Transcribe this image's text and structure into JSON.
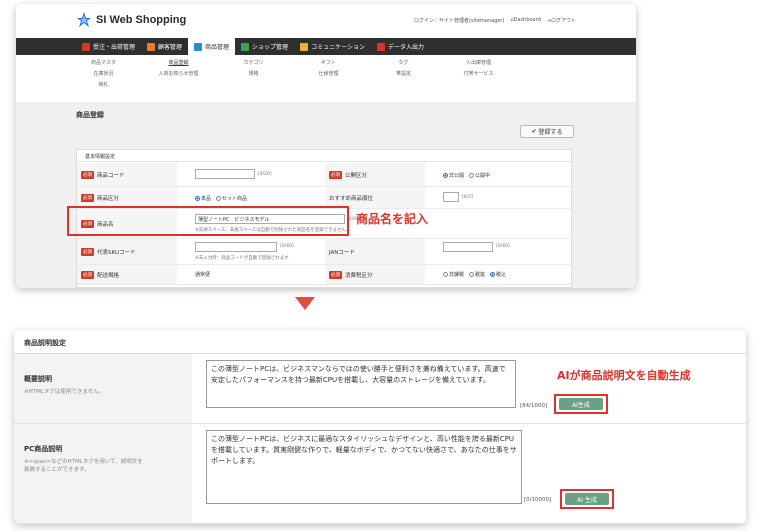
{
  "app": {
    "logo_text": "SI Web Shopping",
    "header_links": [
      "ログイン：サイト管理者(sitemanager)",
      "Dashboard",
      "ログアウト"
    ]
  },
  "nav": {
    "items": [
      {
        "label": "受注・出荷管理",
        "icon": "clipboard-icon",
        "color": "#d23a2a"
      },
      {
        "label": "顧客管理",
        "icon": "person-icon",
        "color": "#e67b2e"
      },
      {
        "label": "商品管理",
        "icon": "grid-icon",
        "color": "#2a8ad6",
        "active": true
      },
      {
        "label": "ショップ管理",
        "icon": "cart-icon",
        "color": "#3aa555"
      },
      {
        "label": "コミュニケーション",
        "icon": "chat-icon",
        "color": "#f0b429"
      },
      {
        "label": "データ入出力",
        "icon": "check-icon",
        "color": "#e0322b"
      }
    ]
  },
  "subnav": {
    "row1": [
      "商品マスタ",
      "商品登録",
      "カテゴリ",
      "ギフト",
      "タグ",
      "入出庫管理"
    ],
    "row2": [
      "在庫状況",
      "入荷お知らせ管理",
      "規格",
      "仕様管理",
      "帯設定",
      "付帯サービス"
    ],
    "row3": [
      "荷札"
    ],
    "active": "商品登録"
  },
  "page": {
    "title": "商品登録",
    "register_button": "登録する"
  },
  "basic_panel": {
    "header": "基本情報設定",
    "required_badge": "必須",
    "product_code": {
      "label": "商品コード",
      "count": "[0/20]"
    },
    "publish": {
      "label": "公開区分",
      "options": [
        "非公開",
        "公開中"
      ]
    },
    "product_type": {
      "label": "商品区分",
      "options": [
        "単品",
        "セット商品"
      ]
    },
    "recommend": {
      "label": "おすすめ商品順位",
      "count": "[0/3]"
    },
    "product_name": {
      "label": "商品名",
      "value": "薄型ノートPC　ビジネスモデル",
      "count": "[0/200]",
      "note": "※先頭スペース、末尾スペースは自動で削除された商品名を登録できません。"
    },
    "sku": {
      "label": "代表SKUコード",
      "count": "[0/40]",
      "note": "※未入力時：商品コードが自動で登録されます"
    },
    "jan": {
      "label": "JANコード",
      "count": "[0/40]"
    },
    "delivery": {
      "label": "配送規格",
      "value": "通常便"
    },
    "tax": {
      "label": "消費税区分",
      "options": [
        "非課税",
        "税抜",
        "税込"
      ]
    }
  },
  "callouts": {
    "name_callout": "商品名を記入",
    "ai_callout": "AIが商品説明文を自動生成"
  },
  "description_panel": {
    "title": "商品説明設定",
    "summary": {
      "label": "概要説明",
      "note": "※HTMLタグは使用できません。",
      "text": "この薄型ノートPCは、ビジネスマンならではの使い勝手と便利さを兼ね備えています。高速で安定したパフォーマンスを持つ最新CPUを搭載し、大容量のストレージを備えています。",
      "counter": "[84/1000]",
      "ai_button": "AI生成"
    },
    "pc": {
      "label": "PC商品説明",
      "note": "※<span>などのHTMLタグを用いて、説明文を装飾することができます。",
      "text": "この薄型ノートPCは、ビジネスに最適なスタイリッシュなデザインと、高い性能を誇る最新CPUを搭載しています。質実剛健な作りで、軽量なボディで、かつてない快適さで、あなたの仕事をサポートします。",
      "counter": "[0/10000]",
      "ai_button": "AI 生成"
    }
  }
}
